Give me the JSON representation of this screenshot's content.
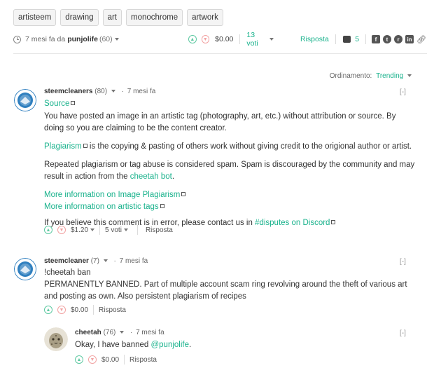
{
  "tags": [
    "artisteem",
    "drawing",
    "art",
    "monochrome",
    "artwork"
  ],
  "post": {
    "time": "7 mesi fa da",
    "author": "punjolife",
    "rep": "(60)",
    "payout": "$0.00",
    "votes": "13 voti",
    "reply": "Risposta",
    "comments_count": "5"
  },
  "sort": {
    "label": "Ordinamento:",
    "value": "Trending"
  },
  "comments": [
    {
      "author": "steemcleaners",
      "rep": "(80)",
      "time": "7 mesi fa",
      "collapse": "[-]",
      "source": "Source",
      "p1": "You have posted an image in an artistic tag (photography, art, etc.) without attribution or source. By doing so you are claiming to be the content creator.",
      "plag_link": "Plagiarism",
      "p2": " is the copying & pasting of others work without giving credit to the origional author or artist.",
      "p3": "Repeated plagiarism or tag abuse is considered spam. Spam is discouraged by the community and may result in action from the ",
      "cheetah_link": "cheetah bot",
      "p3_end": ".",
      "more1": "More information on Image Plagiarism",
      "more2": "More information on artistic tags",
      "p4": "If you believe this comment is in error, please contact us in ",
      "discord_link": "#disputes on Discord",
      "payout": "$1.20",
      "votes": "5 voti",
      "reply": "Risposta"
    },
    {
      "author": "steemcleaner",
      "rep": "(7)",
      "time": "7 mesi fa",
      "collapse": "[-]",
      "line1": "!cheetah ban",
      "line2": "PERMANENTLY BANNED. Part of multiple account scam ring revolving around the theft of various art and posting as own. Also persistent plagiarism of recipes",
      "payout": "$0.00",
      "reply": "Risposta"
    },
    {
      "author": "cheetah",
      "rep": "(76)",
      "time": "7 mesi fa",
      "collapse": "[-]",
      "text_pre": "Okay, I have banned ",
      "mention": "@punjolife",
      "text_post": ".",
      "payout": "$0.00",
      "reply": "Risposta"
    }
  ],
  "colors": {
    "accent": "#19b28c",
    "upvote": "#5ec9a2",
    "downvote": "#f2a3a3"
  }
}
